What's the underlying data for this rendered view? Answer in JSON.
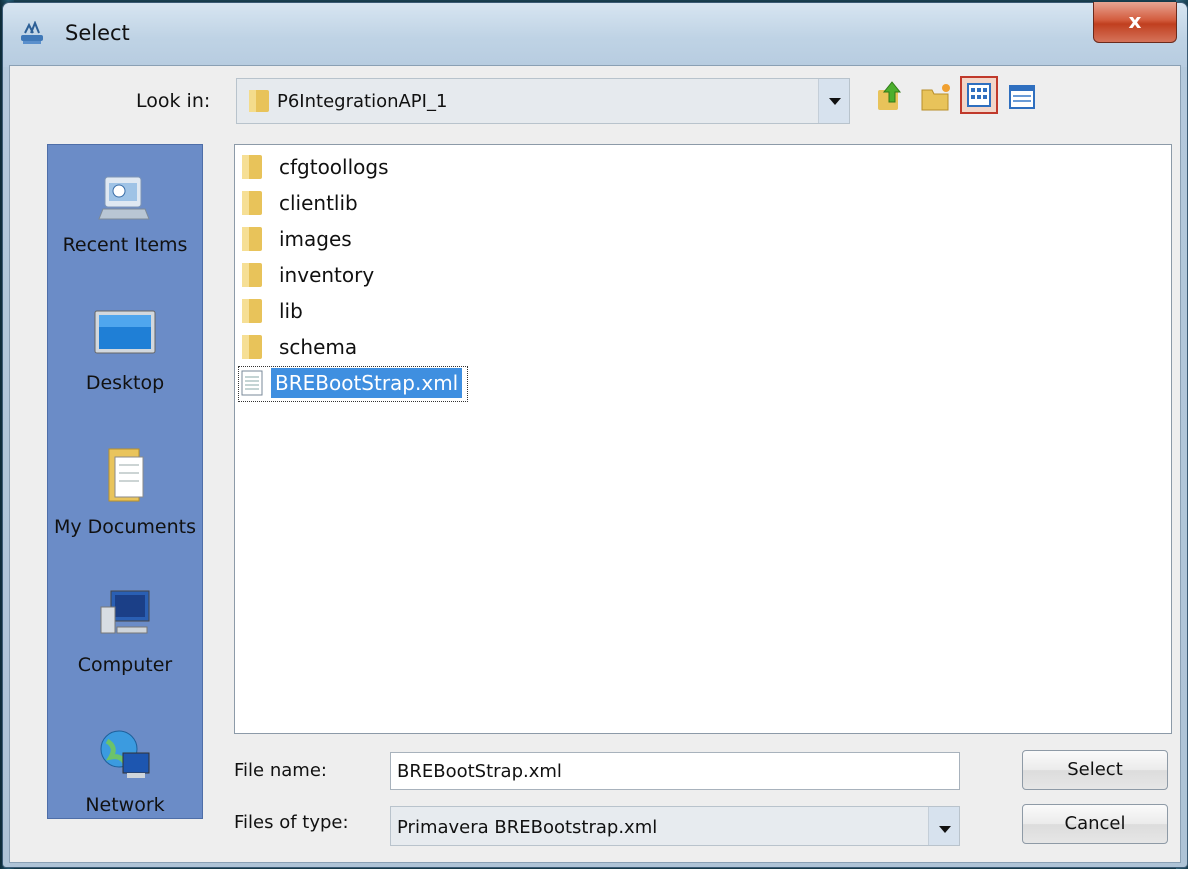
{
  "window": {
    "title": "Select",
    "close_symbol": "x"
  },
  "toolbar": {
    "look_in_label": "Look in:",
    "look_in_value": "P6IntegrationAPI_1",
    "icons": [
      "folder-up-icon",
      "new-folder-icon",
      "list-view-icon",
      "details-view-icon"
    ],
    "active_view": "list"
  },
  "places": [
    {
      "label": "Recent Items",
      "icon": "recent-items-icon"
    },
    {
      "label": "Desktop",
      "icon": "desktop-icon"
    },
    {
      "label": "My Documents",
      "icon": "documents-icon"
    },
    {
      "label": "Computer",
      "icon": "computer-icon"
    },
    {
      "label": "Network",
      "icon": "network-icon"
    }
  ],
  "files": [
    {
      "name": "cfgtoollogs",
      "kind": "folder"
    },
    {
      "name": "clientlib",
      "kind": "folder"
    },
    {
      "name": "images",
      "kind": "folder"
    },
    {
      "name": "inventory",
      "kind": "folder"
    },
    {
      "name": "lib",
      "kind": "folder"
    },
    {
      "name": "schema",
      "kind": "folder"
    },
    {
      "name": "BREBootStrap.xml",
      "kind": "file",
      "selected": true
    }
  ],
  "file_name": {
    "label": "File name:",
    "value": "BREBootStrap.xml"
  },
  "file_type": {
    "label": "Files of type:",
    "value": "Primavera BREBootstrap.xml"
  },
  "buttons": {
    "select": "Select",
    "cancel": "Cancel"
  },
  "colors": {
    "places_bg": "#6b8cc7",
    "selection": "#3f8fe0",
    "close_button": "#c9472a"
  }
}
